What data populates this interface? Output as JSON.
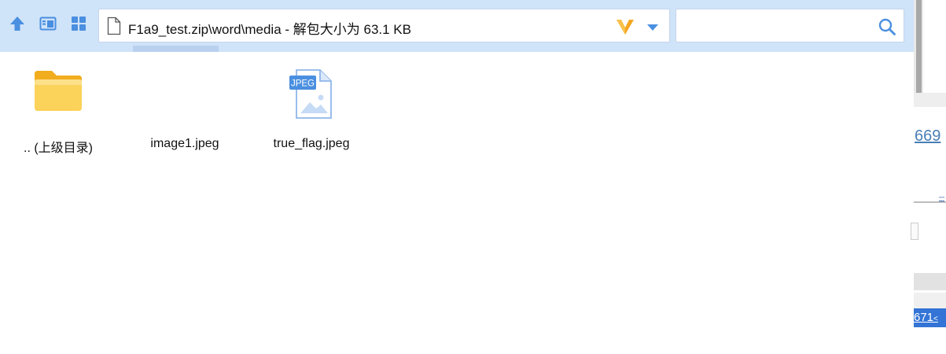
{
  "address": {
    "path": "F1a9_test.zip\\word\\media - 解包大小为 63.1 KB"
  },
  "search": {
    "placeholder": ""
  },
  "files": [
    {
      "name": ".. (上级目录)",
      "type": "folder-up"
    },
    {
      "name": "image1.jpeg",
      "type": "image-blank"
    },
    {
      "name": "true_flag.jpeg",
      "type": "jpeg"
    }
  ],
  "jpeg_badge": "JPEG",
  "background_window": {
    "number_1": "669",
    "number_2": "671",
    "link_suffix": "<"
  },
  "colors": {
    "toolbar_bg": "#cfe3f9",
    "accent_blue": "#4a8fe0",
    "v_logo": "#f5a623",
    "folder_yellow": "#f7c54a"
  },
  "icons": {
    "up": "up-arrow-icon",
    "preview": "preview-pane-icon",
    "view": "grid-view-icon",
    "address_file": "file-icon",
    "brand": "v-logo-icon",
    "dropdown": "dropdown-arrow-icon",
    "search": "search-icon"
  }
}
